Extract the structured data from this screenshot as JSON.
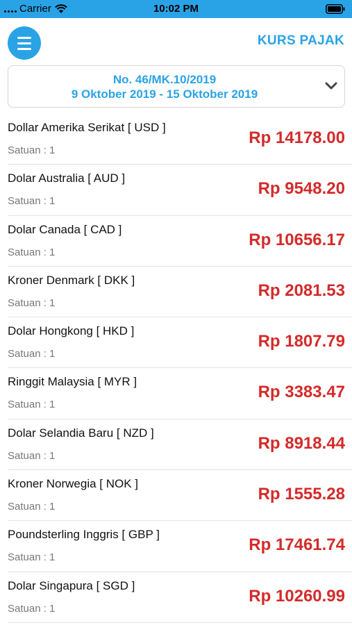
{
  "status_bar": {
    "carrier": "Carrier",
    "time": "10:02 PM"
  },
  "header": {
    "title": "KURS PAJAK",
    "menu_icon": "hamburger-menu-icon"
  },
  "period": {
    "number": "No. 46/MK.10/2019",
    "range": "9 Oktober 2019 - 15 Oktober 2019",
    "icon": "chevron-down-icon"
  },
  "colors": {
    "accent": "#2aa3e6",
    "value": "#d42a2a"
  },
  "rates": [
    {
      "name": "Dollar Amerika Serikat [ USD ]",
      "unit": "Satuan : 1",
      "value": "Rp 14178.00"
    },
    {
      "name": "Dolar Australia [ AUD ]",
      "unit": "Satuan : 1",
      "value": "Rp 9548.20"
    },
    {
      "name": "Dolar Canada [ CAD ]",
      "unit": "Satuan : 1",
      "value": "Rp 10656.17"
    },
    {
      "name": "Kroner Denmark [ DKK ]",
      "unit": "Satuan : 1",
      "value": "Rp 2081.53"
    },
    {
      "name": "Dolar Hongkong [ HKD ]",
      "unit": "Satuan : 1",
      "value": "Rp 1807.79"
    },
    {
      "name": "Ringgit Malaysia [ MYR ]",
      "unit": "Satuan : 1",
      "value": "Rp 3383.47"
    },
    {
      "name": "Dolar Selandia Baru [ NZD ]",
      "unit": "Satuan : 1",
      "value": "Rp 8918.44"
    },
    {
      "name": "Kroner Norwegia [ NOK ]",
      "unit": "Satuan : 1",
      "value": "Rp 1555.28"
    },
    {
      "name": "Poundsterling Inggris [ GBP ]",
      "unit": "Satuan : 1",
      "value": "Rp 17461.74"
    },
    {
      "name": "Dolar Singapura [ SGD ]",
      "unit": "Satuan : 1",
      "value": "Rp 10260.99"
    }
  ]
}
